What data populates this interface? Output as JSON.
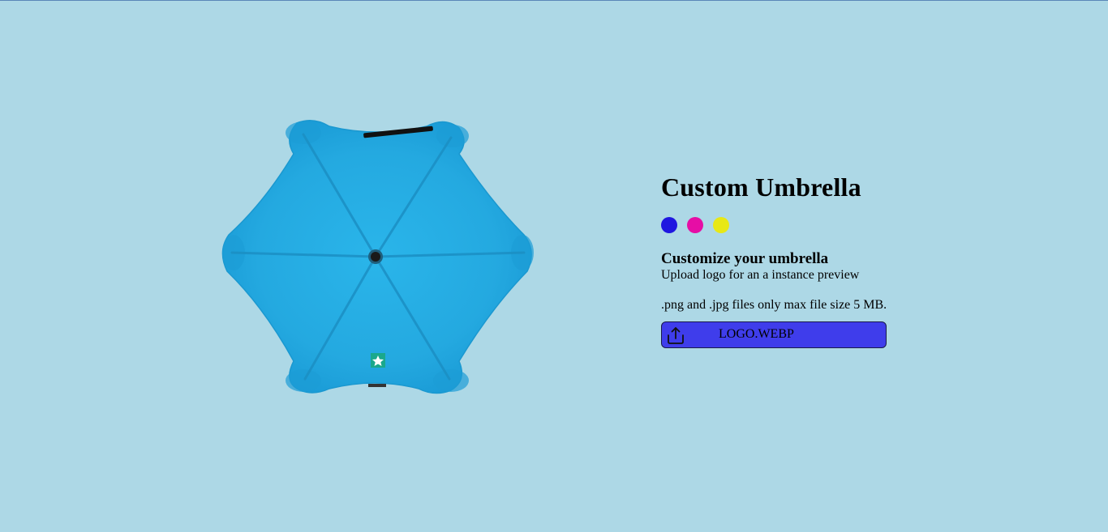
{
  "product": {
    "title": "Custom Umbrella",
    "umbrella_color": "#28aee3",
    "logo_badge_icon": "star-badge-icon",
    "colors": [
      {
        "name": "blue",
        "hex": "#1f17e0"
      },
      {
        "name": "magenta",
        "hex": "#e60ea5"
      },
      {
        "name": "yellow",
        "hex": "#e8e815"
      }
    ]
  },
  "customize": {
    "heading": "Customize your umbrella",
    "description": "Upload logo for an a instance preview",
    "file_note": ".png and .jpg files only max file size 5 MB."
  },
  "upload": {
    "label": "LOGO.WEBP",
    "icon": "upload-icon",
    "color": "#3f3deb"
  }
}
